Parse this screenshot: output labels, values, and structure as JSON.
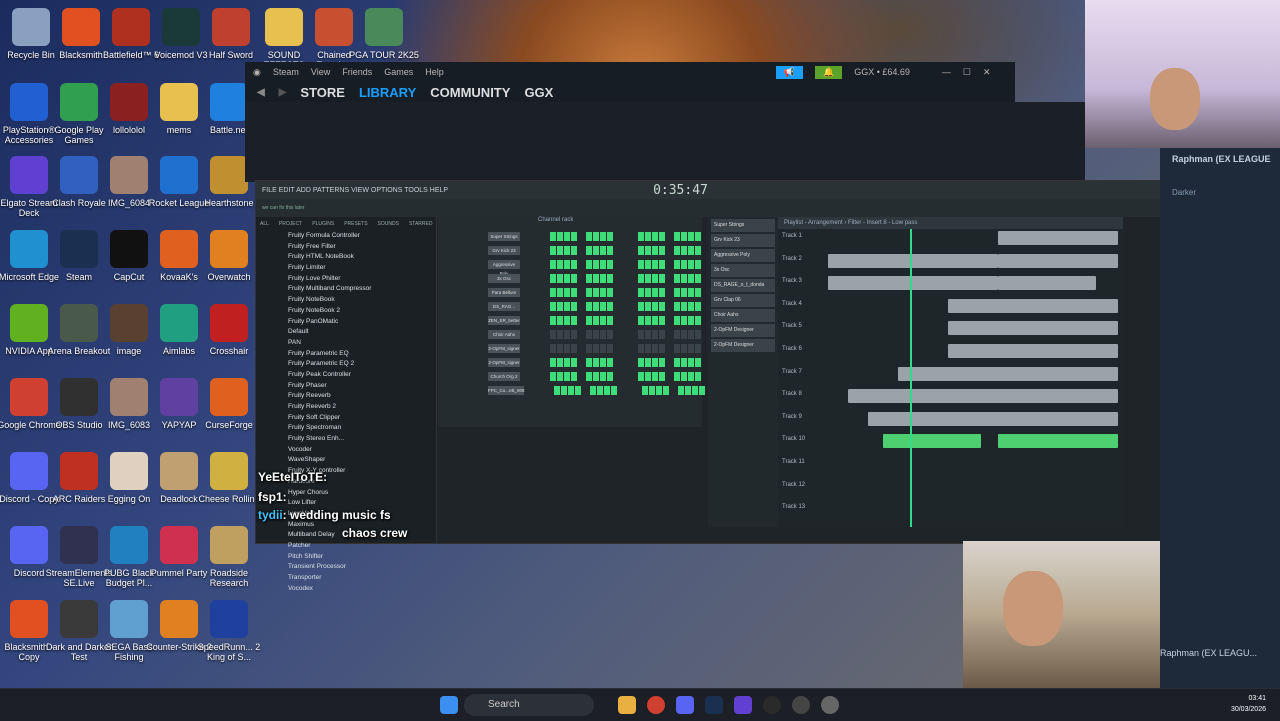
{
  "desktop_icons": [
    {
      "label": "Recycle Bin",
      "color": "#8aa0c0"
    },
    {
      "label": "Blacksmith",
      "color": "#e05020"
    },
    {
      "label": "Battlefield™ 6",
      "color": "#b03020"
    },
    {
      "label": "Voicemod V3",
      "color": "#1a3a3a"
    },
    {
      "label": "Half Sword",
      "color": "#c04030"
    },
    {
      "label": "SOUND EFFECTS",
      "color": "#e8c050"
    },
    {
      "label": "Chained Together",
      "color": "#c85030"
    },
    {
      "label": "PGA TOUR 2K25",
      "color": "#4a8a5a"
    },
    {
      "label": "PlayStation® Accessories",
      "color": "#2060d0"
    },
    {
      "label": "Google Play Games",
      "color": "#30a050"
    },
    {
      "label": "lollololol",
      "color": "#8a2020"
    },
    {
      "label": "mems",
      "color": "#e8c050"
    },
    {
      "label": "Battle.net",
      "color": "#2080e0"
    },
    {
      "label": "Elgato Stream Deck",
      "color": "#6040d0"
    },
    {
      "label": "Clash Royale",
      "color": "#3060c0"
    },
    {
      "label": "IMG_6084",
      "color": "#a08070"
    },
    {
      "label": "Rocket League",
      "color": "#2070d0"
    },
    {
      "label": "Hearthstone",
      "color": "#c09030"
    },
    {
      "label": "Microsoft Edge",
      "color": "#2090d0"
    },
    {
      "label": "Steam",
      "color": "#1a3050"
    },
    {
      "label": "CapCut",
      "color": "#111"
    },
    {
      "label": "KovaaK's",
      "color": "#e06020"
    },
    {
      "label": "Overwatch",
      "color": "#e08020"
    },
    {
      "label": "NVIDIA App",
      "color": "#60b020"
    },
    {
      "label": "Arena Breakout",
      "color": "#4a5a4a"
    },
    {
      "label": "image",
      "color": "#5a4030"
    },
    {
      "label": "Aimlabs",
      "color": "#20a080"
    },
    {
      "label": "Crosshair",
      "color": "#c02020"
    },
    {
      "label": "Google Chrome",
      "color": "#d04030"
    },
    {
      "label": "OBS Studio",
      "color": "#303030"
    },
    {
      "label": "IMG_6083",
      "color": "#a08070"
    },
    {
      "label": "YAPYAP",
      "color": "#6040a0"
    },
    {
      "label": "CurseForge",
      "color": "#e06020"
    },
    {
      "label": "Discord - Copy",
      "color": "#5865f2"
    },
    {
      "label": "ARC Raiders",
      "color": "#c03020"
    },
    {
      "label": "Egging On",
      "color": "#e0d0c0"
    },
    {
      "label": "Deadlock",
      "color": "#c0a070"
    },
    {
      "label": "Cheese Rolling",
      "color": "#d0b040"
    },
    {
      "label": "Discord",
      "color": "#5865f2"
    },
    {
      "label": "StreamElements SE.Live",
      "color": "#303050"
    },
    {
      "label": "PUBG Black Budget Pl...",
      "color": "#2080c0"
    },
    {
      "label": "Pummel Party",
      "color": "#d03050"
    },
    {
      "label": "Roadside Research",
      "color": "#c0a060"
    },
    {
      "label": "Blacksmith - Copy",
      "color": "#e05020"
    },
    {
      "label": "Dark and Darker Test",
      "color": "#3a3a3a"
    },
    {
      "label": "SEGA Bass Fishing",
      "color": "#60a0d0"
    },
    {
      "label": "Counter-Strike 2",
      "color": "#e08020"
    },
    {
      "label": "SpeedRunn... 2 King of S...",
      "color": "#2040a0"
    }
  ],
  "steam": {
    "menu": [
      "Steam",
      "View",
      "Friends",
      "Games",
      "Help"
    ],
    "nav": [
      "STORE",
      "LIBRARY",
      "COMMUNITY",
      "GGX"
    ],
    "account": "GGX • £64.69"
  },
  "fl": {
    "menu": "FILE EDIT ADD PATTERNS VIEW OPTIONS TOOLS HELP",
    "time": "0:35:47",
    "hint": "we can fix this later",
    "browser_tabs": [
      "ALL",
      "PROJECT",
      "PLUGINS",
      "PRESETS",
      "SOUNDS",
      "STARRED"
    ],
    "browser_items": [
      "Fruity Formula Controller",
      "Fruity Free Filter",
      "Fruity HTML NoteBook",
      "Fruity Limiter",
      "Fruity Love Philter",
      "Fruity Multiband Compressor",
      "Fruity NoteBook",
      "Fruity NoteBook 2",
      "Fruity PanOMatic",
      "Default",
      "PAN",
      "Fruity Parametric EQ",
      "Fruity Parametric EQ 2",
      "Fruity Peak Controller",
      "Fruity Phaser",
      "Fruity Reeverb",
      "Fruity Reeverb 2",
      "Fruity Soft Clipper",
      "Fruity Spectroman",
      "Fruity Stereo Enh...",
      "Vocoder",
      "WaveShaper",
      "Fruity X-Y controller",
      "Hardcore",
      "Hyper Chorus",
      "Low Lifter",
      "LuxeVerb",
      "Maximus",
      "Multiband Delay",
      "Patcher",
      "Pitch Shifter",
      "Transient Processor",
      "Transporter",
      "Vocodex"
    ],
    "channel_rack_title": "Channel rack",
    "channels": [
      "Super Strings",
      "Grv Kick 23",
      "Aggressive Poly",
      "3x Osc",
      "Para Bellum",
      "DS_RAG...",
      "ZEN_ER_better",
      "Choir Aahs",
      "2-OpFM_signer",
      "2-OpFM_signer",
      "Church Org 2",
      "FPC_Co...eB_808"
    ],
    "mixer_items": [
      "Super Strings",
      "Grv Kick 23",
      "Aggressive Poly",
      "3x Osc",
      "DS_RAGE_o_t_donda",
      "Grv Clap 06",
      "Choir Aahs",
      "2-OpFM Designer",
      "2-OpFM Designer"
    ],
    "playlist_title": "Playlist - Arrangement › Filter - Insert 8 - Low pass",
    "tracks": [
      "Track 1",
      "Track 2",
      "Track 3",
      "Track 4",
      "Track 5",
      "Track 6",
      "Track 7",
      "Track 8",
      "Track 9",
      "Track 10",
      "Track 11",
      "Track 12",
      "Track 13"
    ]
  },
  "chat": [
    {
      "user": "YeEteIToTE:",
      "msg": "",
      "user_color": "#ffffff"
    },
    {
      "user": "fsp1:",
      "msg": "",
      "user_color": "#ffffff"
    },
    {
      "user": "tydii",
      "msg": ": wedding music fs",
      "user_color": "#40c0ff"
    },
    {
      "user": "",
      "msg": "chaos crew",
      "user_color": "#ff3030"
    }
  ],
  "right_panel": {
    "name_top": "Raphman (EX LEAGUE",
    "sub": "Darker",
    "name_bottom": "Raphman (EX LEAGU..."
  },
  "taskbar": {
    "search": "Search",
    "time": "03:41",
    "date": "30/03/2026"
  }
}
